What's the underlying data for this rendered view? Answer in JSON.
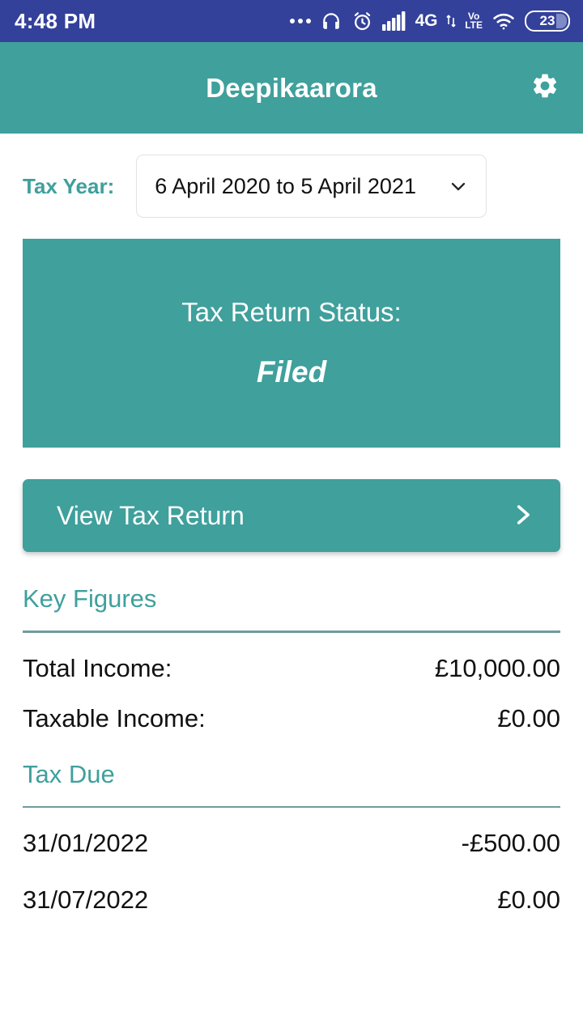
{
  "status_bar": {
    "time": "4:48 PM",
    "icons": [
      {
        "name": "more-dots-icon",
        "label": "..."
      },
      {
        "name": "headphones-icon",
        "label": "headphones"
      },
      {
        "name": "alarm-clock-icon",
        "label": "alarm"
      },
      {
        "name": "signal-bars-icon",
        "label": "signal"
      },
      {
        "name": "network-type-icon",
        "label": "4G"
      },
      {
        "name": "volte-icon",
        "label_top": "VoL",
        "label_bottom": "LTE"
      },
      {
        "name": "wifi-icon",
        "label": "wifi"
      }
    ],
    "network_type": "4G",
    "volte_top": "Vo",
    "volte_bottom": "LTE",
    "battery_level": "23"
  },
  "app_bar": {
    "title": "Deepikaarora",
    "settings_icon": "gear-icon"
  },
  "tax_year": {
    "label": "Tax Year:",
    "selected": "6 April 2020 to 5 April 2021",
    "chevron_icon": "chevron-down-icon"
  },
  "status_card": {
    "label": "Tax Return Status:",
    "value": "Filed"
  },
  "view_button": {
    "label": "View Tax Return",
    "chevron_icon": "chevron-right-icon"
  },
  "key_figures": {
    "title": "Key Figures",
    "rows": [
      {
        "key": "Total Income:",
        "value": "£10,000.00"
      },
      {
        "key": "Taxable Income:",
        "value": "£0.00"
      }
    ]
  },
  "tax_due": {
    "title": "Tax Due",
    "rows": [
      {
        "key": "31/01/2022",
        "value": "-£500.00"
      },
      {
        "key": "31/07/2022",
        "value": "£0.00"
      }
    ]
  },
  "colors": {
    "teal": "#3FA09C",
    "status_bar_blue": "#33419A",
    "rule": "#6e9d9c",
    "text": "#111111"
  }
}
